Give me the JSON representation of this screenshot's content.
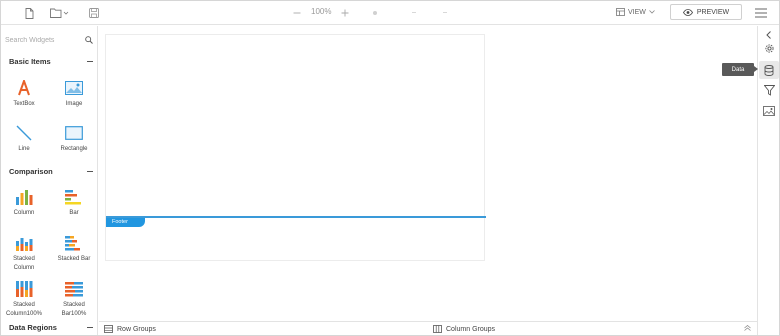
{
  "toolbar": {
    "zoom_level": "100%",
    "view_label": "VIEW",
    "preview_label": "PREVIEW"
  },
  "left_panel": {
    "search_placeholder": "Search Widgets",
    "sections": {
      "basic": "Basic Items",
      "comparison": "Comparison",
      "data_regions": "Data Regions"
    },
    "basic_items": {
      "textbox": "TextBox",
      "image": "Image",
      "line": "Line",
      "rectangle": "Rectangle"
    },
    "comparison_items": {
      "column": "Column",
      "bar": "Bar",
      "stacked_column_1": "Stacked",
      "stacked_column_2": "Column",
      "stacked_bar": "Stacked Bar",
      "stacked_column100_1": "Stacked",
      "stacked_column100_2": "Column100%",
      "stacked_bar100_1": "Stacked",
      "stacked_bar100_2": "Bar100%"
    }
  },
  "canvas": {
    "footer_label": "Footer"
  },
  "groups_bar": {
    "row_groups": "Row Groups",
    "column_groups": "Column Groups"
  },
  "right_panel": {
    "tooltip": "Data"
  },
  "colors": {
    "accent": "#2196e0",
    "textbox_icon": "#e8622a",
    "line_icon": "#3a9ad9"
  }
}
